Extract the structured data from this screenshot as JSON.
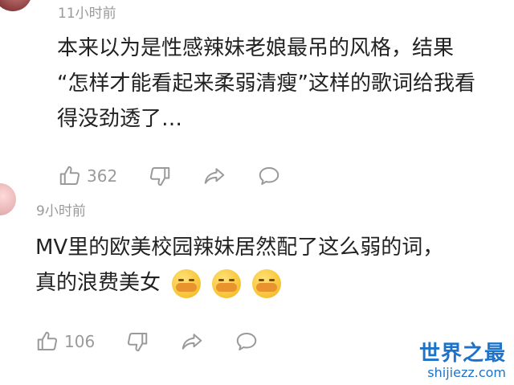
{
  "comments": [
    {
      "time": "11小时前",
      "lines": [
        "本来以为是性感辣妹老娘最吊的风格，结果",
        "“怎样才能看起来柔弱清瘦”这样的歌词给我看",
        "得没劲透了…"
      ],
      "like_count": "362"
    },
    {
      "time": "9小时前",
      "lines": [
        "MV里的欧美校园辣妹居然配了这么弱的词，",
        "真的浪费美女"
      ],
      "like_count": "106"
    }
  ],
  "watermark": {
    "title": "世界之最",
    "url": "shijiezz.com"
  },
  "colors": {
    "meta_gray": "#9a9a9a",
    "watermark_blue": "#1e73c9",
    "emoji_yellow": "#f7c232"
  }
}
